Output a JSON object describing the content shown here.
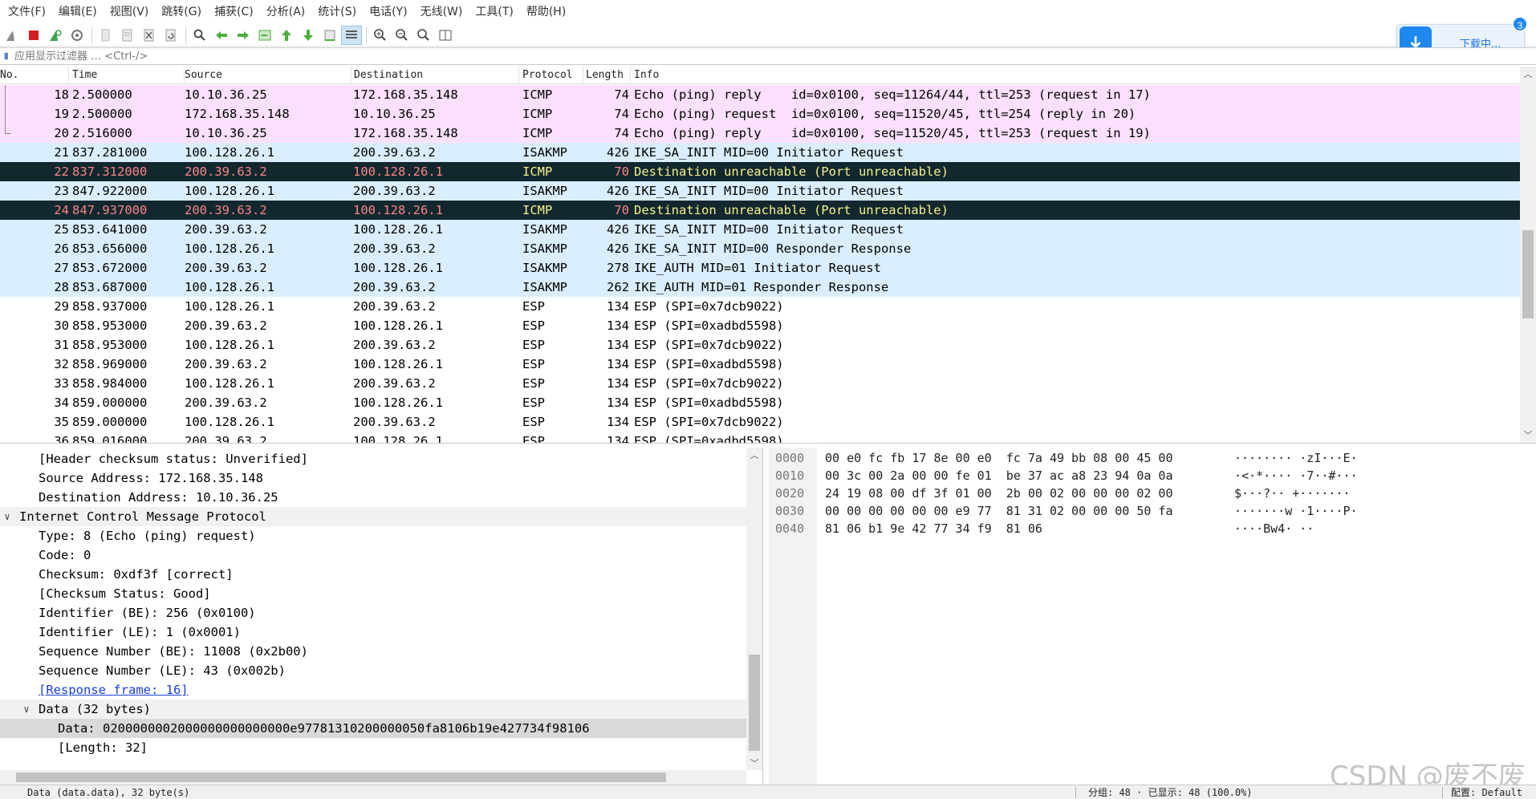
{
  "menu": [
    "文件(F)",
    "编辑(E)",
    "视图(V)",
    "跳转(G)",
    "捕获(C)",
    "分析(A)",
    "统计(S)",
    "电话(Y)",
    "无线(W)",
    "工具(T)",
    "帮助(H)"
  ],
  "toolbar": {
    "icons": [
      "shark-fin-start-icon",
      "stop-capture-icon",
      "restart-capture-icon",
      "capture-options-icon",
      "open-file-icon",
      "save-file-icon",
      "close-file-icon",
      "reload-icon",
      "find-packet-icon",
      "go-back-icon",
      "go-forward-icon",
      "go-to-packet-icon",
      "first-packet-icon",
      "last-packet-icon",
      "auto-scroll-icon",
      "colorize-icon",
      "zoom-in-icon",
      "zoom-out-icon",
      "normal-size-icon",
      "resize-columns-icon"
    ]
  },
  "filter": {
    "placeholder": "应用显示过滤器 … <Ctrl-/>"
  },
  "download": {
    "label": "下载中...",
    "count": "3"
  },
  "packet_list": {
    "columns": [
      "No.",
      "Time",
      "Source",
      "Destination",
      "Protocol",
      "Length",
      "Info"
    ],
    "rows": [
      {
        "no": "18",
        "time": "2.500000",
        "src": "10.10.36.25",
        "dst": "172.168.35.148",
        "proto": "ICMP",
        "len": "74",
        "info": "Echo (ping) reply    id=0x0100, seq=11264/44, ttl=253 (request in 17)",
        "style": "icmp-echo"
      },
      {
        "no": "19",
        "time": "2.500000",
        "src": "172.168.35.148",
        "dst": "10.10.36.25",
        "proto": "ICMP",
        "len": "74",
        "info": "Echo (ping) request  id=0x0100, seq=11520/45, ttl=254 (reply in 20)",
        "style": "icmp-echo"
      },
      {
        "no": "20",
        "time": "2.516000",
        "src": "10.10.36.25",
        "dst": "172.168.35.148",
        "proto": "ICMP",
        "len": "74",
        "info": "Echo (ping) reply    id=0x0100, seq=11520/45, ttl=253 (request in 19)",
        "style": "icmp-echo"
      },
      {
        "no": "21",
        "time": "837.281000",
        "src": "100.128.26.1",
        "dst": "200.39.63.2",
        "proto": "ISAKMP",
        "len": "426",
        "info": "IKE_SA_INIT MID=00 Initiator Request",
        "style": "isakmp"
      },
      {
        "no": "22",
        "time": "837.312000",
        "src": "200.39.63.2",
        "dst": "100.128.26.1",
        "proto": "ICMP",
        "len": "70",
        "info": "Destination unreachable (Port unreachable)",
        "style": "error"
      },
      {
        "no": "23",
        "time": "847.922000",
        "src": "100.128.26.1",
        "dst": "200.39.63.2",
        "proto": "ISAKMP",
        "len": "426",
        "info": "IKE_SA_INIT MID=00 Initiator Request",
        "style": "isakmp"
      },
      {
        "no": "24",
        "time": "847.937000",
        "src": "200.39.63.2",
        "dst": "100.128.26.1",
        "proto": "ICMP",
        "len": "70",
        "info": "Destination unreachable (Port unreachable)",
        "style": "error"
      },
      {
        "no": "25",
        "time": "853.641000",
        "src": "200.39.63.2",
        "dst": "100.128.26.1",
        "proto": "ISAKMP",
        "len": "426",
        "info": "IKE_SA_INIT MID=00 Initiator Request",
        "style": "isakmp"
      },
      {
        "no": "26",
        "time": "853.656000",
        "src": "100.128.26.1",
        "dst": "200.39.63.2",
        "proto": "ISAKMP",
        "len": "426",
        "info": "IKE_SA_INIT MID=00 Responder Response",
        "style": "isakmp"
      },
      {
        "no": "27",
        "time": "853.672000",
        "src": "200.39.63.2",
        "dst": "100.128.26.1",
        "proto": "ISAKMP",
        "len": "278",
        "info": "IKE_AUTH MID=01 Initiator Request",
        "style": "isakmp"
      },
      {
        "no": "28",
        "time": "853.687000",
        "src": "100.128.26.1",
        "dst": "200.39.63.2",
        "proto": "ISAKMP",
        "len": "262",
        "info": "IKE_AUTH MID=01 Responder Response",
        "style": "isakmp"
      },
      {
        "no": "29",
        "time": "858.937000",
        "src": "100.128.26.1",
        "dst": "200.39.63.2",
        "proto": "ESP",
        "len": "134",
        "info": "ESP (SPI=0x7dcb9022)",
        "style": "plain"
      },
      {
        "no": "30",
        "time": "858.953000",
        "src": "200.39.63.2",
        "dst": "100.128.26.1",
        "proto": "ESP",
        "len": "134",
        "info": "ESP (SPI=0xadbd5598)",
        "style": "plain"
      },
      {
        "no": "31",
        "time": "858.953000",
        "src": "100.128.26.1",
        "dst": "200.39.63.2",
        "proto": "ESP",
        "len": "134",
        "info": "ESP (SPI=0x7dcb9022)",
        "style": "plain"
      },
      {
        "no": "32",
        "time": "858.969000",
        "src": "200.39.63.2",
        "dst": "100.128.26.1",
        "proto": "ESP",
        "len": "134",
        "info": "ESP (SPI=0xadbd5598)",
        "style": "plain"
      },
      {
        "no": "33",
        "time": "858.984000",
        "src": "100.128.26.1",
        "dst": "200.39.63.2",
        "proto": "ESP",
        "len": "134",
        "info": "ESP (SPI=0x7dcb9022)",
        "style": "plain"
      },
      {
        "no": "34",
        "time": "859.000000",
        "src": "200.39.63.2",
        "dst": "100.128.26.1",
        "proto": "ESP",
        "len": "134",
        "info": "ESP (SPI=0xadbd5598)",
        "style": "plain"
      },
      {
        "no": "35",
        "time": "859.000000",
        "src": "100.128.26.1",
        "dst": "200.39.63.2",
        "proto": "ESP",
        "len": "134",
        "info": "ESP (SPI=0x7dcb9022)",
        "style": "plain"
      },
      {
        "no": "36",
        "time": "859.016000",
        "src": "200.39.63.2",
        "dst": "100.128.26.1",
        "proto": "ESP",
        "len": "134",
        "info": "ESP (SPI=0xadbd5598)",
        "style": "plain"
      }
    ]
  },
  "detail": {
    "lines": [
      {
        "text": "[Header checksum status: Unverified]",
        "indent": 1,
        "kind": "leaf"
      },
      {
        "text": "Source Address: 172.168.35.148",
        "indent": 1,
        "kind": "leaf"
      },
      {
        "text": "Destination Address: 10.10.36.25",
        "indent": 1,
        "kind": "leaf"
      },
      {
        "text": "Internet Control Message Protocol",
        "indent": 0,
        "kind": "section",
        "expander": "∨"
      },
      {
        "text": "Type: 8 (Echo (ping) request)",
        "indent": 1,
        "kind": "leaf"
      },
      {
        "text": "Code: 0",
        "indent": 1,
        "kind": "leaf"
      },
      {
        "text": "Checksum: 0xdf3f [correct]",
        "indent": 1,
        "kind": "leaf"
      },
      {
        "text": "[Checksum Status: Good]",
        "indent": 1,
        "kind": "leaf"
      },
      {
        "text": "Identifier (BE): 256 (0x0100)",
        "indent": 1,
        "kind": "leaf"
      },
      {
        "text": "Identifier (LE): 1 (0x0001)",
        "indent": 1,
        "kind": "leaf"
      },
      {
        "text": "Sequence Number (BE): 11008 (0x2b00)",
        "indent": 1,
        "kind": "leaf"
      },
      {
        "text": "Sequence Number (LE): 43 (0x002b)",
        "indent": 1,
        "kind": "leaf"
      },
      {
        "text": "[Response frame: 16]",
        "indent": 1,
        "kind": "link"
      },
      {
        "text": "Data (32 bytes)",
        "indent": 1,
        "kind": "section",
        "expander": "∨"
      },
      {
        "text": "Data: 0200000002000000000000000e97781310200000050fa8106b19e427734f98106",
        "indent": 2,
        "kind": "selected"
      },
      {
        "text": "[Length: 32]",
        "indent": 2,
        "kind": "leaf"
      }
    ]
  },
  "bytes": {
    "lines": [
      {
        "offset": "0000",
        "hex": "00 e0 fc fb 17 8e 00 e0  fc 7a 49 bb 08 00 45 00",
        "ascii": "········ ·zI···E·"
      },
      {
        "offset": "0010",
        "hex": "00 3c 00 2a 00 00 fe 01  be 37 ac a8 23 94 0a 0a",
        "ascii": "·<·*···· ·7··#···"
      },
      {
        "offset": "0020",
        "hex": "24 19 08 00 df 3f 01 00  2b 00 02 00 00 00 02 00",
        "ascii": "$···?·· +·······"
      },
      {
        "offset": "0030",
        "hex": "00 00 00 00 00 00 e9 77  81 31 02 00 00 00 50 fa",
        "ascii": "·······w ·1····P·"
      },
      {
        "offset": "0040",
        "hex": "81 06 b1 9e 42 77 34 f9  81 06",
        "ascii": "····Bw4· ··"
      }
    ]
  },
  "watermark": "CSDN @废不废",
  "status": {
    "left": "Data (data.data), 32 byte(s)",
    "middle": "分组: 48 · 已显示: 48 (100.0%)",
    "right": "配置: Default"
  }
}
